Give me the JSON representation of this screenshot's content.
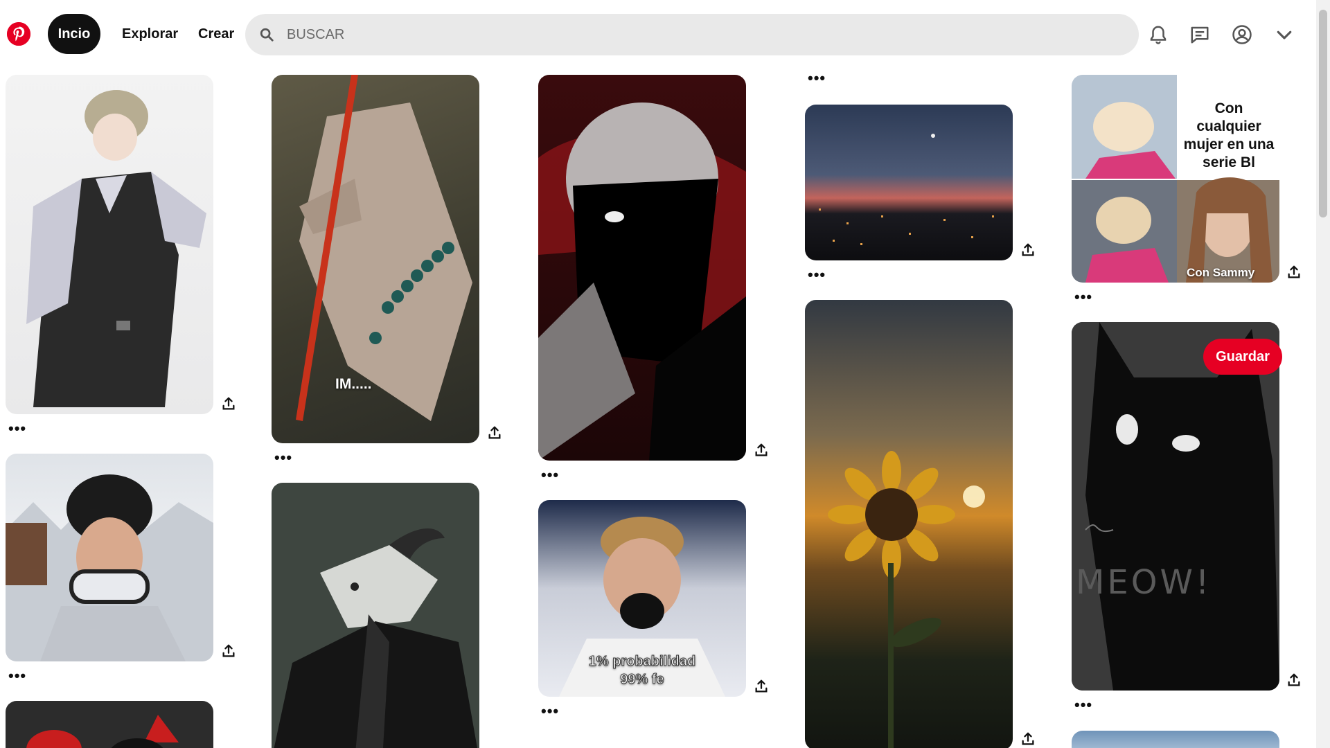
{
  "nav": {
    "home": "Incio",
    "explore": "Explorar",
    "create": "Crear"
  },
  "search": {
    "placeholder": "BUSCAR"
  },
  "icons": {
    "logo": "pinterest-logo",
    "search": "search-icon",
    "notifications": "bell-icon",
    "messages": "message-icon",
    "profile": "user-icon",
    "menu": "chevron-down-icon",
    "share": "share-icon",
    "more": "more-icon"
  },
  "colors": {
    "brand": "#e60023",
    "home_pill": "#111111",
    "search_bg": "#e9e9e9"
  },
  "pins": {
    "p1": {
      "caption": ""
    },
    "p3": {
      "caption": "IM....."
    },
    "p6": {
      "caption_line1": "1% probabilidad",
      "caption_line2": "99% fe"
    },
    "p9": {
      "caption_top": "Con cualquier mujer en una serie Bl",
      "caption_bottom": "Con Sammy"
    },
    "p10": {
      "drawn_text": "MEOW!"
    }
  },
  "save_label": "Guardar",
  "more_label": "•••"
}
